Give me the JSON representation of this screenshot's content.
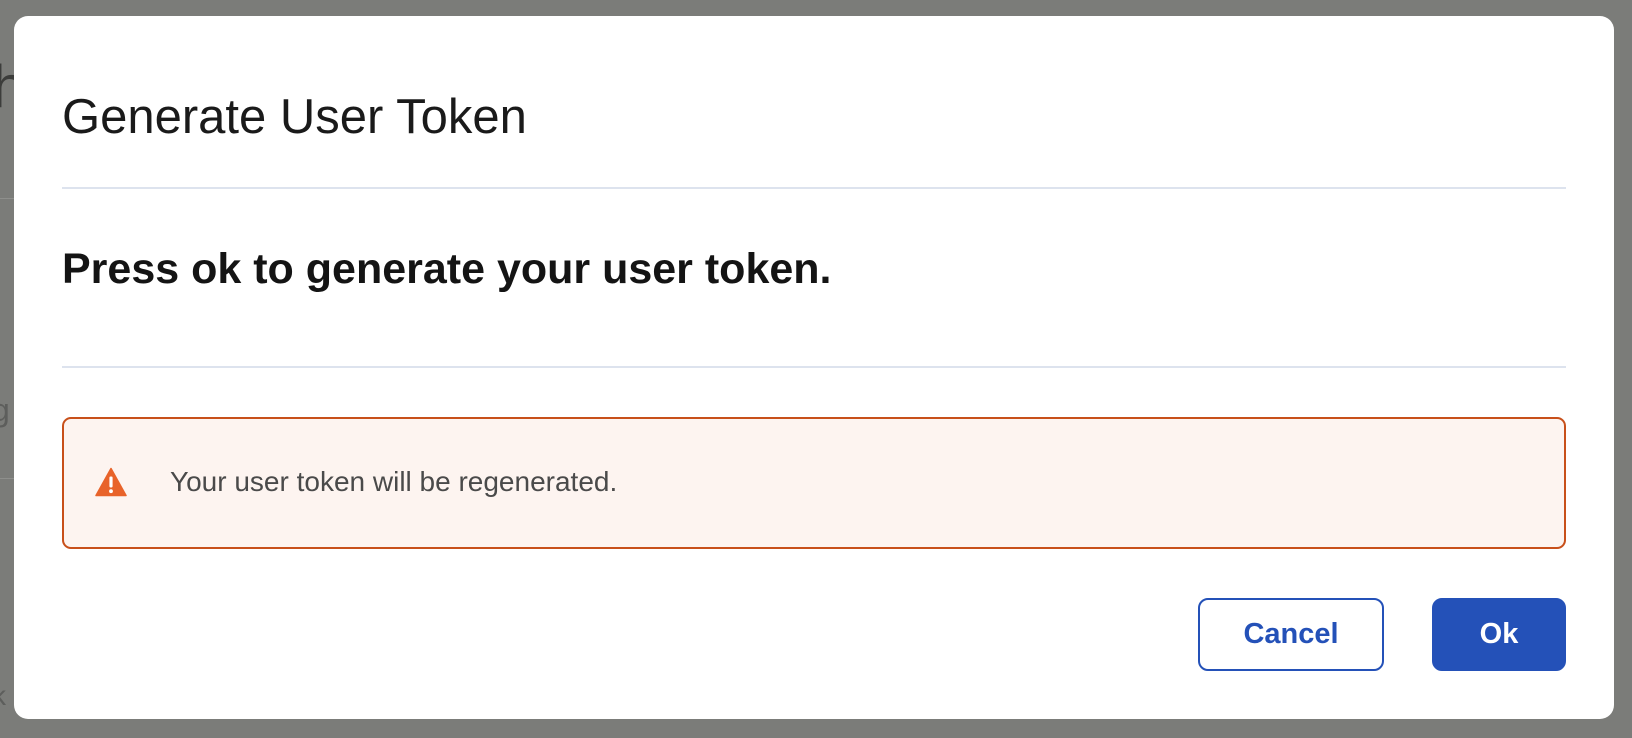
{
  "dialog": {
    "title": "Generate User Token",
    "message": "Press ok to generate your user token.",
    "warning": {
      "icon": "warning-triangle-icon",
      "text": "Your user token will be regenerated.",
      "color": "#c8501a"
    },
    "buttons": {
      "cancel_label": "Cancel",
      "ok_label": "Ok"
    },
    "accent_color": "#2451b8"
  },
  "background": {
    "glyphs": [
      "h",
      "g",
      "k"
    ]
  }
}
